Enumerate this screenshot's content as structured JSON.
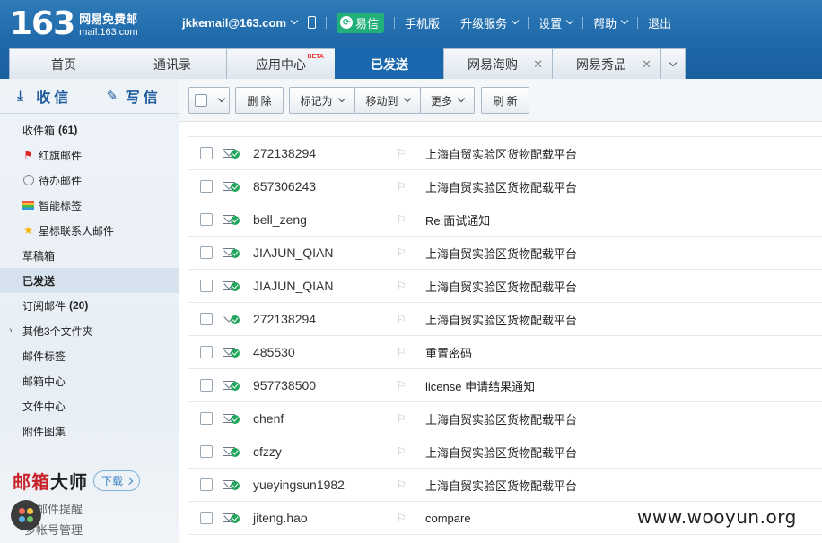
{
  "brand": {
    "number": "163",
    "name": "网易免费邮",
    "domain": "mail.163.com"
  },
  "topbar": {
    "email": "jkkemail@163.com",
    "yixin": "易信",
    "mobile": "手机版",
    "upgrade": "升级服务",
    "settings": "设置",
    "help": "帮助",
    "logout": "退出"
  },
  "tabs": [
    {
      "label": "首页"
    },
    {
      "label": "通讯录"
    },
    {
      "label": "应用中心",
      "badge": "BETA"
    },
    {
      "label": "已发送"
    },
    {
      "label": "网易海购"
    },
    {
      "label": "网易秀品"
    }
  ],
  "sidebar": {
    "receive": "收信",
    "compose": "写信",
    "folders": [
      {
        "label": "收件箱",
        "count": "(61)"
      },
      {
        "label": "红旗邮件"
      },
      {
        "label": "待办邮件"
      },
      {
        "label": "智能标签"
      },
      {
        "label": "星标联系人邮件"
      },
      {
        "label": "草稿箱"
      },
      {
        "label": "已发送"
      },
      {
        "label": "订阅邮件",
        "count": "(20)"
      },
      {
        "label": "其他3个文件夹"
      },
      {
        "label": "邮件标签"
      },
      {
        "label": "邮箱中心"
      },
      {
        "label": "文件中心"
      },
      {
        "label": "附件图集"
      }
    ],
    "master": {
      "title_red": "邮箱",
      "title_black": "大师",
      "download": "下载",
      "line1": "新邮件提醒",
      "line2": "多帐号管理"
    }
  },
  "toolbar": {
    "delete": "删 除",
    "mark": "标记为",
    "move": "移动到",
    "more": "更多",
    "refresh": "刷 新"
  },
  "mails": [
    {
      "to": "272138294",
      "subject": "上海自贸实验区货物配载平台"
    },
    {
      "to": "857306243",
      "subject": "上海自贸实验区货物配载平台"
    },
    {
      "to": "bell_zeng",
      "subject": "Re:面试通知"
    },
    {
      "to": "JIAJUN_QIAN",
      "subject": "上海自贸实验区货物配载平台"
    },
    {
      "to": "JIAJUN_QIAN",
      "subject": "上海自贸实验区货物配载平台"
    },
    {
      "to": "272138294",
      "subject": "上海自贸实验区货物配载平台"
    },
    {
      "to": "485530",
      "subject": "重置密码"
    },
    {
      "to": "957738500",
      "subject": "license 申请结果通知"
    },
    {
      "to": "chenf",
      "subject": "上海自贸实验区货物配载平台"
    },
    {
      "to": "cfzzy",
      "subject": "上海自贸实验区货物配载平台"
    },
    {
      "to": "yueyingsun1982",
      "subject": "上海自贸实验区货物配载平台"
    },
    {
      "to": "jiteng.hao",
      "subject": "compare"
    }
  ],
  "watermark": "www.wooyun.org"
}
